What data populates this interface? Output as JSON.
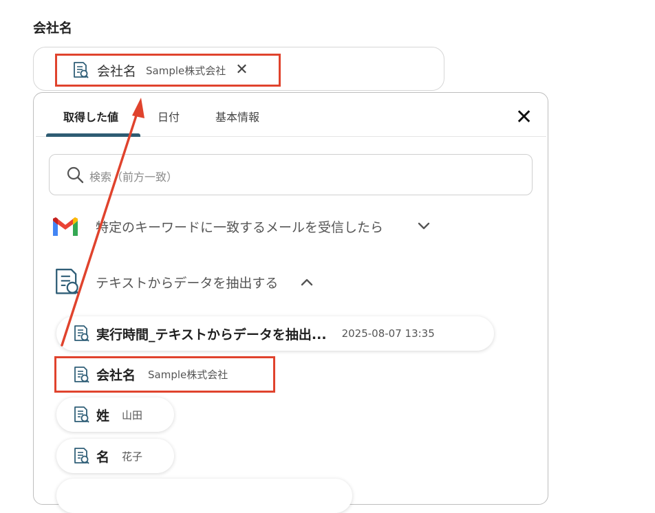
{
  "field": {
    "label": "会社名",
    "chip": {
      "name": "会社名",
      "value": "Sample株式会社",
      "close_glyph": "✕",
      "icon": "document-search-icon"
    }
  },
  "picker": {
    "tabs": [
      {
        "label": "取得した値",
        "active": true
      },
      {
        "label": "日付",
        "active": false
      },
      {
        "label": "基本情報",
        "active": false
      }
    ],
    "close_glyph": "✕",
    "search": {
      "placeholder": "検索（前方一致）",
      "icon": "search-icon"
    },
    "groups": [
      {
        "title": "特定のキーワードに一致するメールを受信したら",
        "icon": "gmail-icon",
        "expanded": false
      },
      {
        "title": "テキストからデータを抽出する",
        "icon": "document-search-icon",
        "expanded": true
      }
    ],
    "items": [
      {
        "name": "実行時間_テキストからデータを抽出...",
        "value": "2025-08-07 13:35",
        "highlighted": false
      },
      {
        "name": "会社名",
        "value": "Sample株式会社",
        "highlighted": true
      },
      {
        "name": "姓",
        "value": "山田",
        "highlighted": false
      },
      {
        "name": "名",
        "value": "花子",
        "highlighted": false
      }
    ]
  },
  "colors": {
    "highlight": "#e0432d",
    "tab_accent": "#2e5c73",
    "icon": "#2f5e77"
  },
  "annotation": {
    "type": "arrow",
    "color": "#e0432d",
    "from": "list-item-company-name",
    "to": "selected-chip"
  }
}
